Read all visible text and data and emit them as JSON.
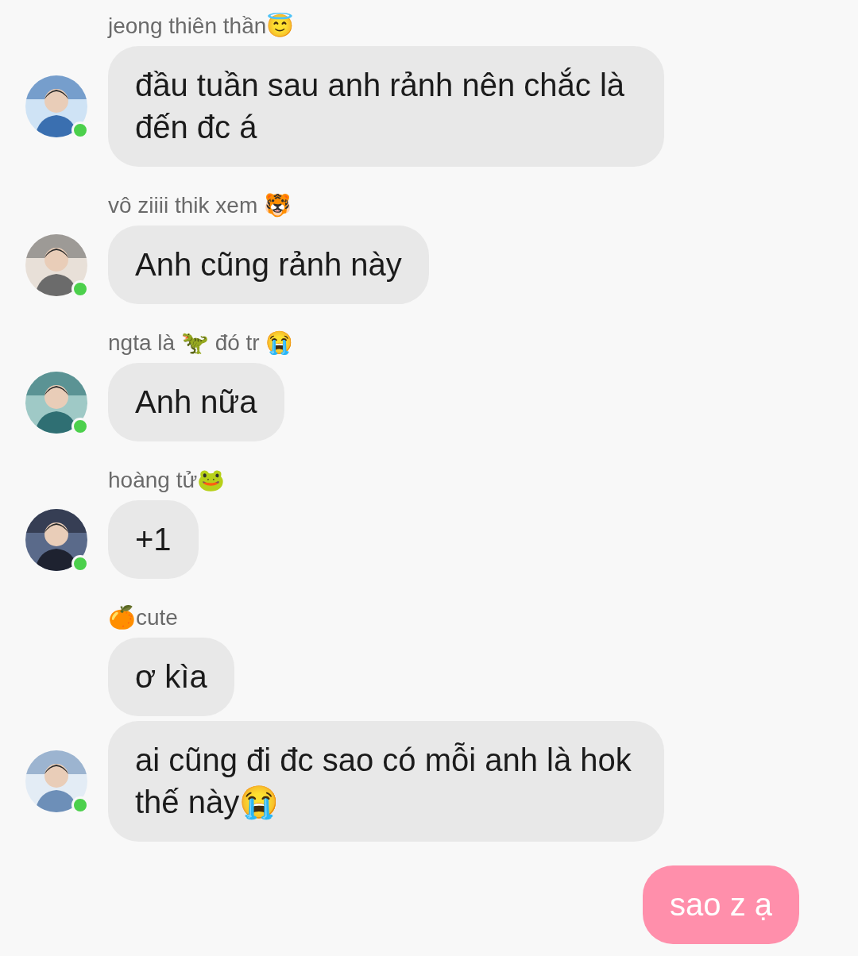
{
  "messages": [
    {
      "sender": "jeong thiên thần😇",
      "online": true,
      "texts": [
        "đầu tuần sau anh rảnh nên chắc là đến đc á"
      ]
    },
    {
      "sender": "vô ziiii thik xem 🐯",
      "online": true,
      "texts": [
        "Anh cũng rảnh này"
      ]
    },
    {
      "sender": "ngta là 🦖 đó tr 😭",
      "online": true,
      "texts": [
        "Anh nữa"
      ]
    },
    {
      "sender": "hoàng tử🐸",
      "online": true,
      "texts": [
        "+1"
      ]
    },
    {
      "sender": "🍊cute",
      "online": true,
      "texts": [
        "ơ kìa",
        "ai cũng đi đc sao có mỗi anh là hok thế này😭"
      ]
    }
  ],
  "outgoing": [
    {
      "text": "sao z ạ"
    }
  ]
}
